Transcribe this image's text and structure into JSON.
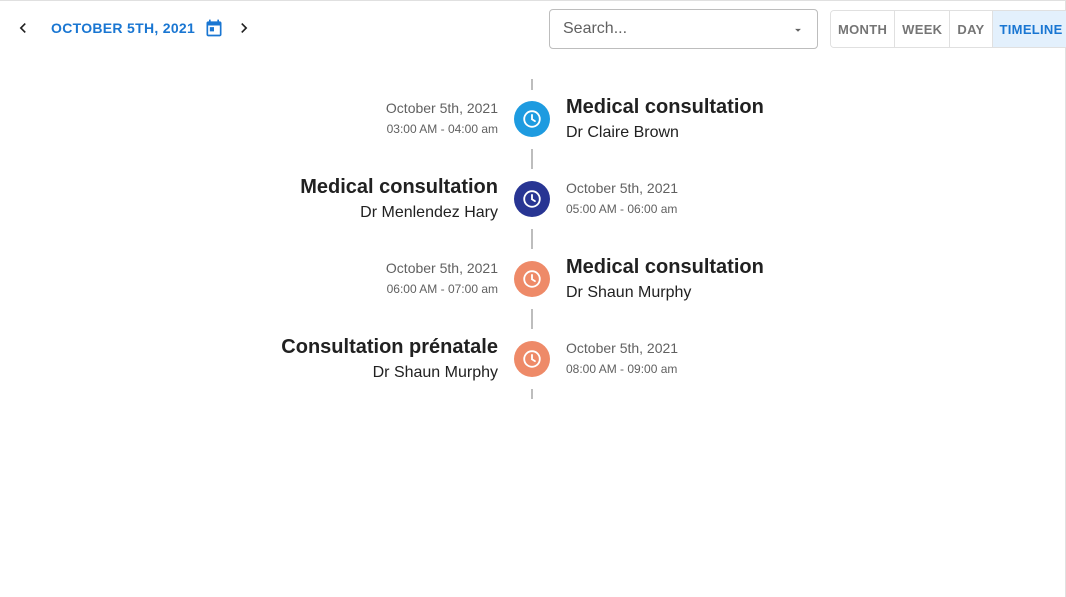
{
  "toolbar": {
    "current_date": "OCTOBER 5TH, 2021",
    "search_placeholder": "Search...",
    "views": [
      "MONTH",
      "WEEK",
      "DAY",
      "TIMELINE"
    ],
    "active_view": "TIMELINE"
  },
  "colors": {
    "accent": "#1976d2",
    "dot_blue": "#1e9be0",
    "dot_navy": "#283593",
    "dot_orange": "#ee8a68"
  },
  "icons": {
    "prev": "chevron-left-icon",
    "next": "chevron-right-icon",
    "calendar": "calendar-icon",
    "dropdown": "caret-down-icon",
    "event": "clock-icon"
  },
  "events": [
    {
      "title": "Medical consultation",
      "doctor": "Dr Claire Brown",
      "date": "October 5th, 2021",
      "time": "03:00 AM - 04:00 am",
      "color": "#1e9be0"
    },
    {
      "title": "Medical consultation",
      "doctor": "Dr Menlendez Hary",
      "date": "October 5th, 2021",
      "time": "05:00 AM - 06:00 am",
      "color": "#283593"
    },
    {
      "title": "Medical consultation",
      "doctor": "Dr Shaun Murphy",
      "date": "October 5th, 2021",
      "time": "06:00 AM - 07:00 am",
      "color": "#ee8a68"
    },
    {
      "title": "Consultation prénatale",
      "doctor": "Dr Shaun Murphy",
      "date": "October 5th, 2021",
      "time": "08:00 AM - 09:00 am",
      "color": "#ee8a68"
    }
  ]
}
